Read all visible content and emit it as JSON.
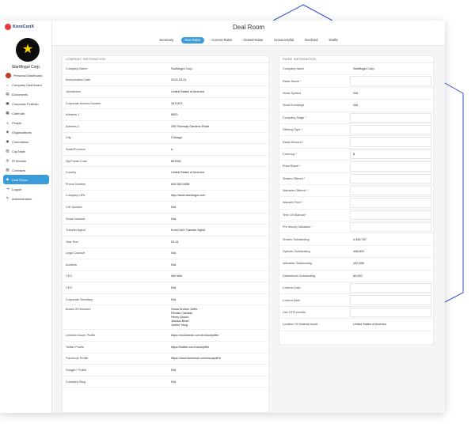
{
  "brand": {
    "name": "KoreConX"
  },
  "company_name": "StarMogul Corp.",
  "page_title": "Deal Room",
  "sidebar": {
    "items": [
      {
        "label": "Personal Dashboard",
        "icon": "avatar-icon"
      },
      {
        "label": "Company Dashboard",
        "icon": "home-icon"
      },
      {
        "label": "Documents",
        "icon": "document-icon"
      },
      {
        "label": "Corporate Portfolio",
        "icon": "briefcase-icon"
      },
      {
        "label": "Calendar",
        "icon": "calendar-icon"
      },
      {
        "label": "People",
        "icon": "people-icon"
      },
      {
        "label": "Organizations",
        "icon": "organization-icon"
      },
      {
        "label": "Committees",
        "icon": "committee-icon"
      },
      {
        "label": "CapTable",
        "icon": "table-icon"
      },
      {
        "label": "IR Module",
        "icon": "ir-icon"
      },
      {
        "label": "Contracts",
        "icon": "contract-icon"
      },
      {
        "label": "Deal Room",
        "icon": "deal-icon"
      },
      {
        "label": "Logout",
        "icon": "logout-icon"
      },
      {
        "label": "Administration",
        "icon": "wrench-icon"
      }
    ],
    "active": "Deal Room"
  },
  "tabs": [
    "Summary",
    "New Raise",
    "Current Raise",
    "Closed Raise",
    "Unsuccessful",
    "Declined",
    "Drafts"
  ],
  "active_tab": "New Raise",
  "company_info": {
    "heading": "COMPANY INFORMATION",
    "rows": [
      {
        "label": "Company Name",
        "value": "StarMogul Corp."
      },
      {
        "label": "Incorporation Date",
        "value": "2015-03-01"
      },
      {
        "label": "Jurisdiction",
        "value": "United States of America"
      },
      {
        "label": "Corporate Access Number",
        "value": "3471871"
      },
      {
        "label": "Address 1",
        "value": "8500"
      },
      {
        "label": "Address 2",
        "value": "205 Shorway Gardens Road"
      },
      {
        "label": "City",
        "value": "Chicago"
      },
      {
        "label": "State/Province",
        "value": "IL"
      },
      {
        "label": "Zip/Postal Code",
        "value": "897654"
      },
      {
        "label": "Country",
        "value": "United States of America"
      },
      {
        "label": "Phone Number",
        "value": "649.382.0058"
      },
      {
        "label": "Company URL",
        "value": "http://www.starmogul.com"
      },
      {
        "label": "CIK Number",
        "value": "N/A"
      },
      {
        "label": "Sedar Number",
        "value": "N/A"
      },
      {
        "label": "Transfer Agent",
        "value": "KoreConX Transfer Agent"
      },
      {
        "label": "Year End",
        "value": "03-31"
      },
      {
        "label": "Legal Counsel",
        "value": "N/A"
      },
      {
        "label": "Auditors",
        "value": "N/A"
      },
      {
        "label": "CEO",
        "value": "Wei Wei"
      },
      {
        "label": "CFO",
        "value": "N/A"
      },
      {
        "label": "Corporate Secretary",
        "value": "N/A"
      },
      {
        "label": "Board Of Directors",
        "value": "Oscar Andres Joffre\nRenato Calzado\nHenry Quach\nJessica Bean\nJunhui Yang",
        "multi": true
      },
      {
        "label": "Linkedin Issuer Profile",
        "value": "https://ca.linkedin.com/in/oscarjoffre"
      },
      {
        "label": "Twitter Profile",
        "value": "https://twitter.com/oscarjoffre"
      },
      {
        "label": "Facebook Profile",
        "value": "https://www.facebook.com/oscarjoffre"
      },
      {
        "label": "Google+ Profile",
        "value": "N/A"
      },
      {
        "label": "Company Blog",
        "value": "N/A"
      }
    ]
  },
  "raise_info": {
    "heading": "RAISE INFORMATION",
    "rows": [
      {
        "label": "Company Name",
        "value": "StarMogul Corp."
      },
      {
        "label": "Raise Name",
        "required": true,
        "input": true,
        "value": ""
      },
      {
        "label": "Stock Symbol",
        "value": "N/A"
      },
      {
        "label": "Stock Exchange",
        "value": "N/A"
      },
      {
        "label": "Company Stage",
        "required": true,
        "input": true,
        "value": ""
      },
      {
        "label": "Offering Type",
        "required": true,
        "input": true,
        "value": ""
      },
      {
        "label": "Raise Amount",
        "required": true,
        "input": true,
        "value": ""
      },
      {
        "label": "Currency",
        "required": true,
        "input": true,
        "value": "$"
      },
      {
        "label": "Price/Share",
        "required": true,
        "input": true,
        "value": ""
      },
      {
        "label": "Shares Offered",
        "required": true,
        "input": true,
        "value": ""
      },
      {
        "label": "Warrants Offered",
        "required": true,
        "input": true,
        "value": ""
      },
      {
        "label": "Warrant Price",
        "required": true,
        "input": true,
        "value": ""
      },
      {
        "label": "Term Of Warrant",
        "required": true,
        "input": true,
        "value": ""
      },
      {
        "label": "Pre Money Valuation",
        "required": true,
        "input": true,
        "value": ""
      },
      {
        "label": "Shares Outstanding",
        "value": "4,345,787"
      },
      {
        "label": "Options Outstanding",
        "value": "408,500"
      },
      {
        "label": "Warrants Outstanding",
        "value": "192,655"
      },
      {
        "label": "Debentures Outstanding",
        "value": "60,000"
      },
      {
        "label": "Current Cash",
        "input": true,
        "value": ""
      },
      {
        "label": "Current Debt",
        "input": true,
        "value": ""
      },
      {
        "label": "Use Of Proceeds",
        "input": true,
        "value": ""
      },
      {
        "label": "Location Of Material Asset",
        "value": "United States of America"
      }
    ]
  },
  "colors": {
    "accent": "#3b9cdc",
    "deco_line": "#2d4fd0",
    "brand": "#e63946"
  }
}
